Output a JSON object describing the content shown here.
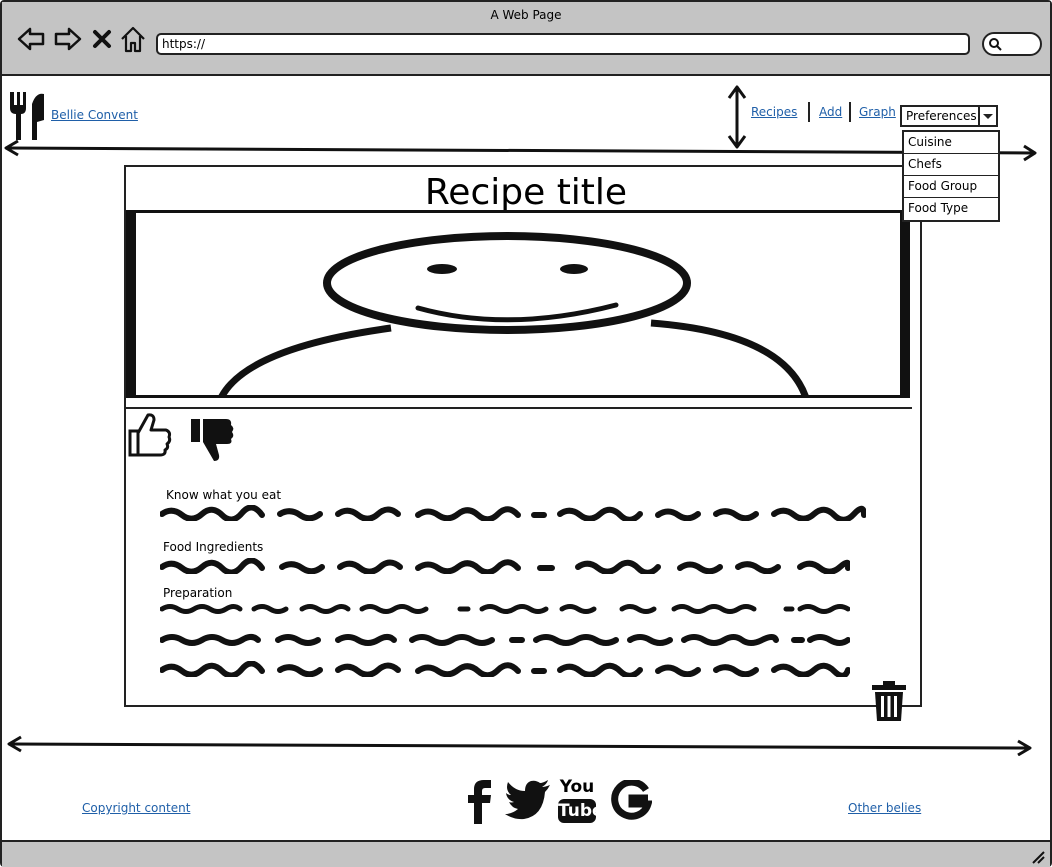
{
  "window": {
    "title": "A Web Page"
  },
  "browser": {
    "url": "https://"
  },
  "header": {
    "brand": "Bellie Convent",
    "nav": {
      "recipes": "Recipes",
      "add": "Add",
      "graph": "Graph"
    },
    "preferences": {
      "selected": "Preferences",
      "options": [
        "Cuisine",
        "Chefs",
        "Food Group",
        "Food Type"
      ]
    }
  },
  "recipe": {
    "title": "Recipe title",
    "sections": {
      "know": "Know what you eat",
      "ingredients": "Food Ingredients",
      "preparation": "Preparation"
    }
  },
  "footer": {
    "copyright": "Copyright content",
    "other": "Other belies",
    "social_icons": [
      "facebook-icon",
      "twitter-icon",
      "youtube-icon",
      "google-icon"
    ],
    "youtube_top": "You",
    "youtube_bottom": "Tube"
  }
}
